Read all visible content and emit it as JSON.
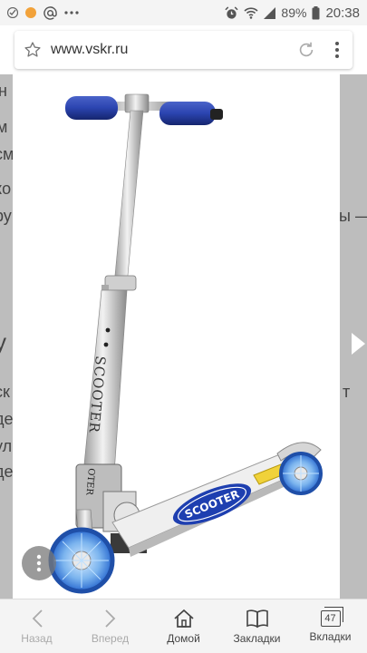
{
  "statusbar": {
    "battery_percent": "89%",
    "time": "20:38"
  },
  "addressbar": {
    "url": "www.vskr.ru"
  },
  "background_page": {
    "fragments": [
      "н",
      "м",
      "см",
      "ко",
      "ру",
      "у",
      "ск",
      "де",
      "ул",
      "де",
      "ы —",
      "т"
    ]
  },
  "image": {
    "logo_text_stem": "SCOOTER",
    "logo_text_deck": "SCOOTER",
    "logo_text_fold": "OTER"
  },
  "bottom_nav": {
    "back": "Назад",
    "forward": "Вперед",
    "home": "Домой",
    "bookmarks": "Закладки",
    "tabs": "Вкладки",
    "tab_count": "47"
  }
}
